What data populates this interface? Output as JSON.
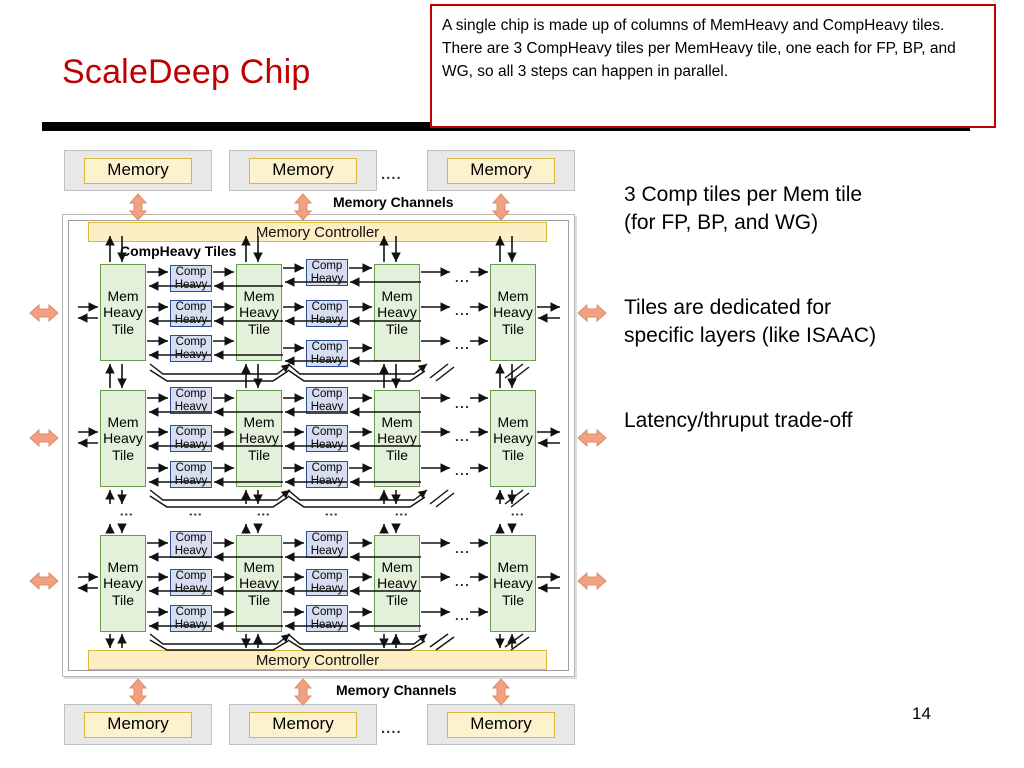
{
  "slide": {
    "title": "ScaleDeep Chip",
    "page_number": "14",
    "title_color": "#C00000"
  },
  "callout": {
    "text": "A single chip is made up of columns of MemHeavy and CompHeavy tiles.  There are 3 CompHeavy tiles per MemHeavy tile, one each for FP, BP, and WG, so all 3 steps can happen in parallel.",
    "border_color": "#C00000"
  },
  "notes": [
    "3 Comp tiles per Mem tile\n(for FP, BP, and WG)",
    "Tiles are dedicated for\nspecific layers (like ISAAC)",
    "Latency/thruput trade-off"
  ],
  "diagram": {
    "memory_label": "Memory",
    "memory_dots": "....",
    "memory_channels_label": "Memory Channels",
    "memory_controller_label": "Memory Controller",
    "compheavy_tiles_label": "CompHeavy Tiles",
    "mem_tile_lines": [
      "Mem",
      "Heavy",
      "Tile"
    ],
    "comp_tile_lines": [
      "Comp",
      "Heavy"
    ],
    "horizontal_ellipsis": "...",
    "vertical_ellipsis": "⋮",
    "colors": {
      "mem_tile_fill": "#E3F0DA",
      "mem_tile_border": "#6A9A4E",
      "comp_tile_fill": "#D6DEF0",
      "comp_tile_border": "#2B4C9B",
      "memory_fill": "#FDF2CE",
      "memory_border": "#D9B93C",
      "memory_outer_fill": "#E8E8E8",
      "controller_fill": "#FDEEC4",
      "channel_arrow": "#EFA181"
    },
    "top_memories": [
      "Memory",
      "Memory",
      "Memory"
    ],
    "bottom_memories": [
      "Memory",
      "Memory",
      "Memory"
    ],
    "tile_rows": 3,
    "tile_columns": 4,
    "comp_per_mem": 3
  }
}
